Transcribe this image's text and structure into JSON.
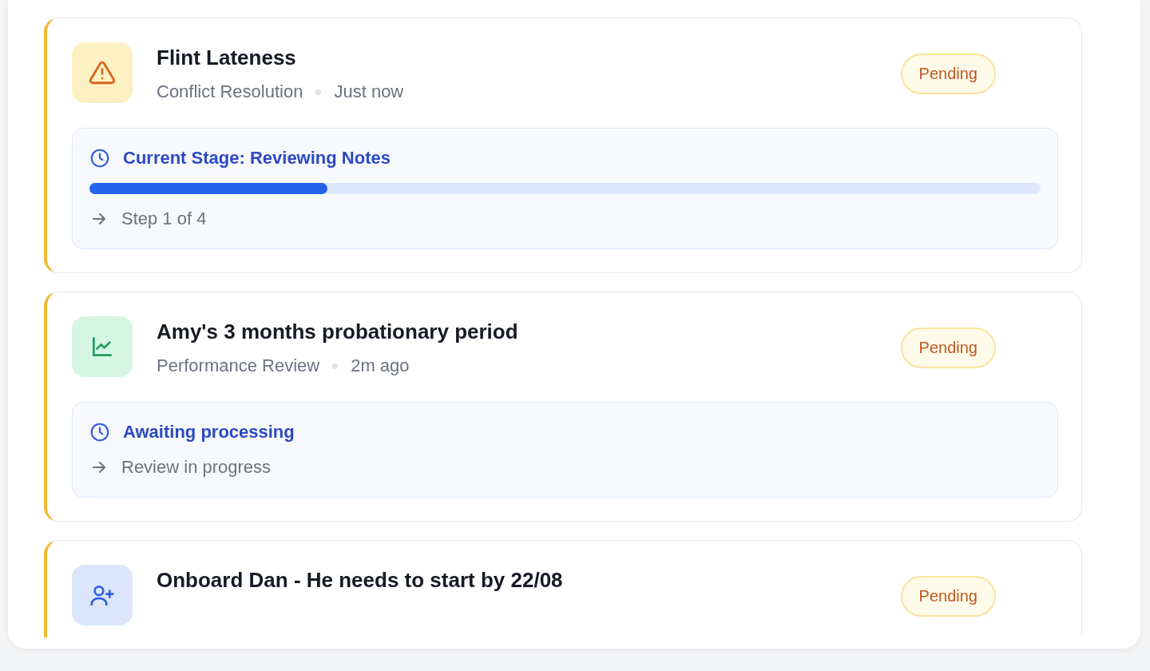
{
  "tasks": [
    {
      "kind": "warning",
      "title": "Flint Lateness",
      "category": "Conflict Resolution",
      "time": "Just now",
      "status": "Pending",
      "stage": {
        "title": "Current Stage: Reviewing Notes",
        "level": 0.25,
        "note": "Step 1 of 4"
      }
    },
    {
      "kind": "chart",
      "title": "Amy's 3 months probationary period",
      "category": "Performance Review",
      "time": "2m ago",
      "status": "Pending",
      "stage": {
        "title": "Awaiting processing",
        "note": "Review in progress"
      }
    },
    {
      "kind": "user-plus",
      "title": "Onboard Dan - He needs to start by 22/08",
      "status": "Pending"
    }
  ]
}
